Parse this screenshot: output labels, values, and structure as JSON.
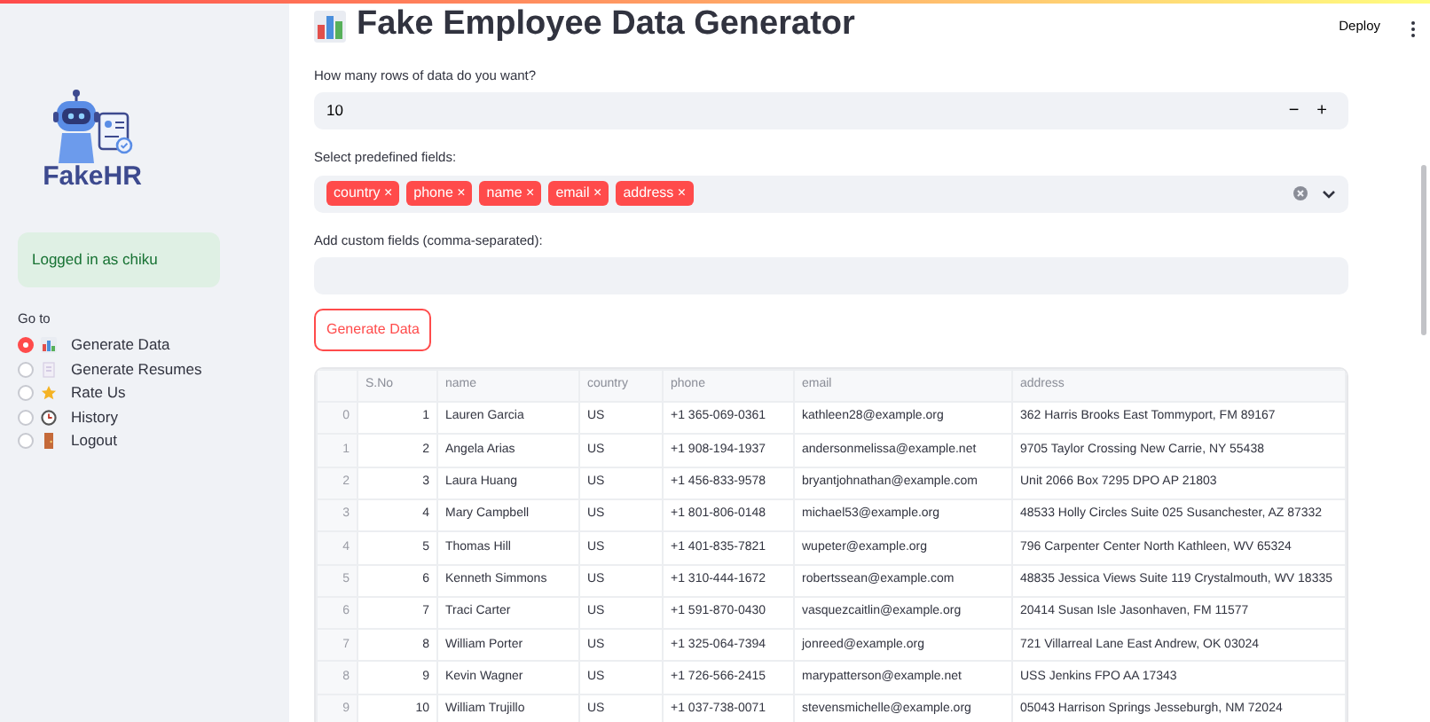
{
  "sidebar": {
    "logo_text": "FakeHR",
    "login_message": "Logged in as chiku",
    "nav_label": "Go to",
    "nav_items": [
      {
        "label": "Generate Data",
        "kind": "chart",
        "selected": true
      },
      {
        "label": "Generate Resumes",
        "kind": "document",
        "selected": false
      },
      {
        "label": "Rate Us",
        "kind": "star",
        "selected": false
      },
      {
        "label": "History",
        "kind": "clock",
        "selected": false
      },
      {
        "label": "Logout",
        "kind": "door",
        "selected": false
      }
    ]
  },
  "header": {
    "deploy": "Deploy"
  },
  "title": "Fake Employee Data Generator",
  "rows_field": {
    "label": "How many rows of data do you want?",
    "value": "10",
    "minus": "−",
    "plus": "+"
  },
  "fields_select": {
    "label": "Select predefined fields:",
    "tags": [
      "country",
      "phone",
      "name",
      "email",
      "address"
    ],
    "tag_close": "×"
  },
  "custom_field": {
    "label": "Add custom fields (comma-separated):"
  },
  "generate_button": "Generate Data",
  "table": {
    "columns": [
      "S.No",
      "name",
      "country",
      "phone",
      "email",
      "address"
    ],
    "rows": [
      {
        "index": "0",
        "cells": [
          "1",
          "Lauren Garcia",
          "US",
          "+1 365-069-0361",
          "kathleen28@example.org",
          "362 Harris Brooks East Tommyport, FM 89167"
        ]
      },
      {
        "index": "1",
        "cells": [
          "2",
          "Angela Arias",
          "US",
          "+1 908-194-1937",
          "andersonmelissa@example.net",
          "9705 Taylor Crossing New Carrie, NY 55438"
        ]
      },
      {
        "index": "2",
        "cells": [
          "3",
          "Laura Huang",
          "US",
          "+1 456-833-9578",
          "bryantjohnathan@example.com",
          "Unit 2066 Box 7295 DPO AP 21803"
        ]
      },
      {
        "index": "3",
        "cells": [
          "4",
          "Mary Campbell",
          "US",
          "+1 801-806-0148",
          "michael53@example.org",
          "48533 Holly Circles Suite 025 Susanchester, AZ 87332"
        ]
      },
      {
        "index": "4",
        "cells": [
          "5",
          "Thomas Hill",
          "US",
          "+1 401-835-7821",
          "wupeter@example.org",
          "796 Carpenter Center North Kathleen, WV 65324"
        ]
      },
      {
        "index": "5",
        "cells": [
          "6",
          "Kenneth Simmons",
          "US",
          "+1 310-444-1672",
          "robertssean@example.com",
          "48835 Jessica Views Suite 119 Crystalmouth, WV 18335"
        ]
      },
      {
        "index": "6",
        "cells": [
          "7",
          "Traci Carter",
          "US",
          "+1 591-870-0430",
          "vasquezcaitlin@example.org",
          "20414 Susan Isle Jasonhaven, FM 11577"
        ]
      },
      {
        "index": "7",
        "cells": [
          "8",
          "William Porter",
          "US",
          "+1 325-064-7394",
          "jonreed@example.org",
          "721 Villarreal Lane East Andrew, OK 03024"
        ]
      },
      {
        "index": "8",
        "cells": [
          "9",
          "Kevin Wagner",
          "US",
          "+1 726-566-2415",
          "marypatterson@example.net",
          "USS Jenkins FPO AA 17343"
        ]
      },
      {
        "index": "9",
        "cells": [
          "10",
          "William Trujillo",
          "US",
          "+1 037-738-0071",
          "stevensmichelle@example.org",
          "05043 Harrison Springs Jesseburgh, NM 72024"
        ]
      }
    ]
  }
}
